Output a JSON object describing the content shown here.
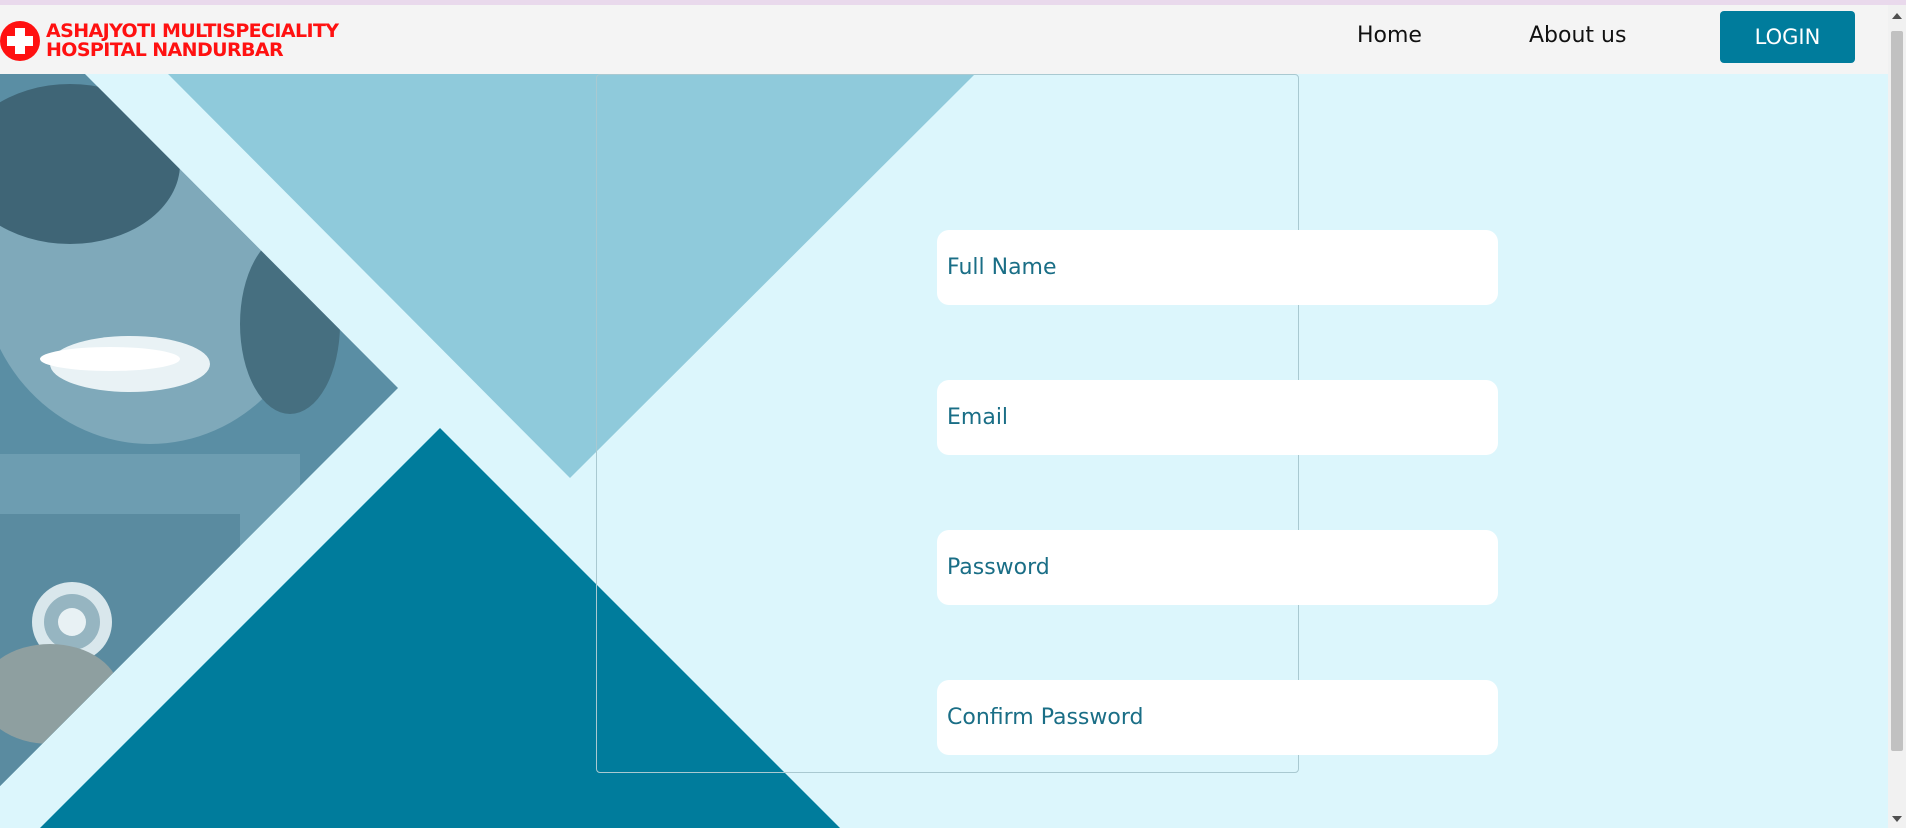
{
  "header": {
    "brand_line1": "ASHAJYOTI MULTISPECIALITY",
    "brand_line2": "HOSPITAL NANDURBAR",
    "brand_icon": "red-cross-icon",
    "nav": {
      "home": "Home",
      "about": "About us"
    },
    "login_label": "LOGIN"
  },
  "form": {
    "full_name_placeholder": "Full Name",
    "email_placeholder": "Email",
    "password_placeholder": "Password",
    "confirm_password_placeholder": "Confirm Password"
  },
  "colors": {
    "background": "#dcf6fc",
    "accent": "#007c9c",
    "light_triangle": "#8fcadb",
    "brand_red": "#ff1111",
    "field_text": "#1a6e86"
  }
}
